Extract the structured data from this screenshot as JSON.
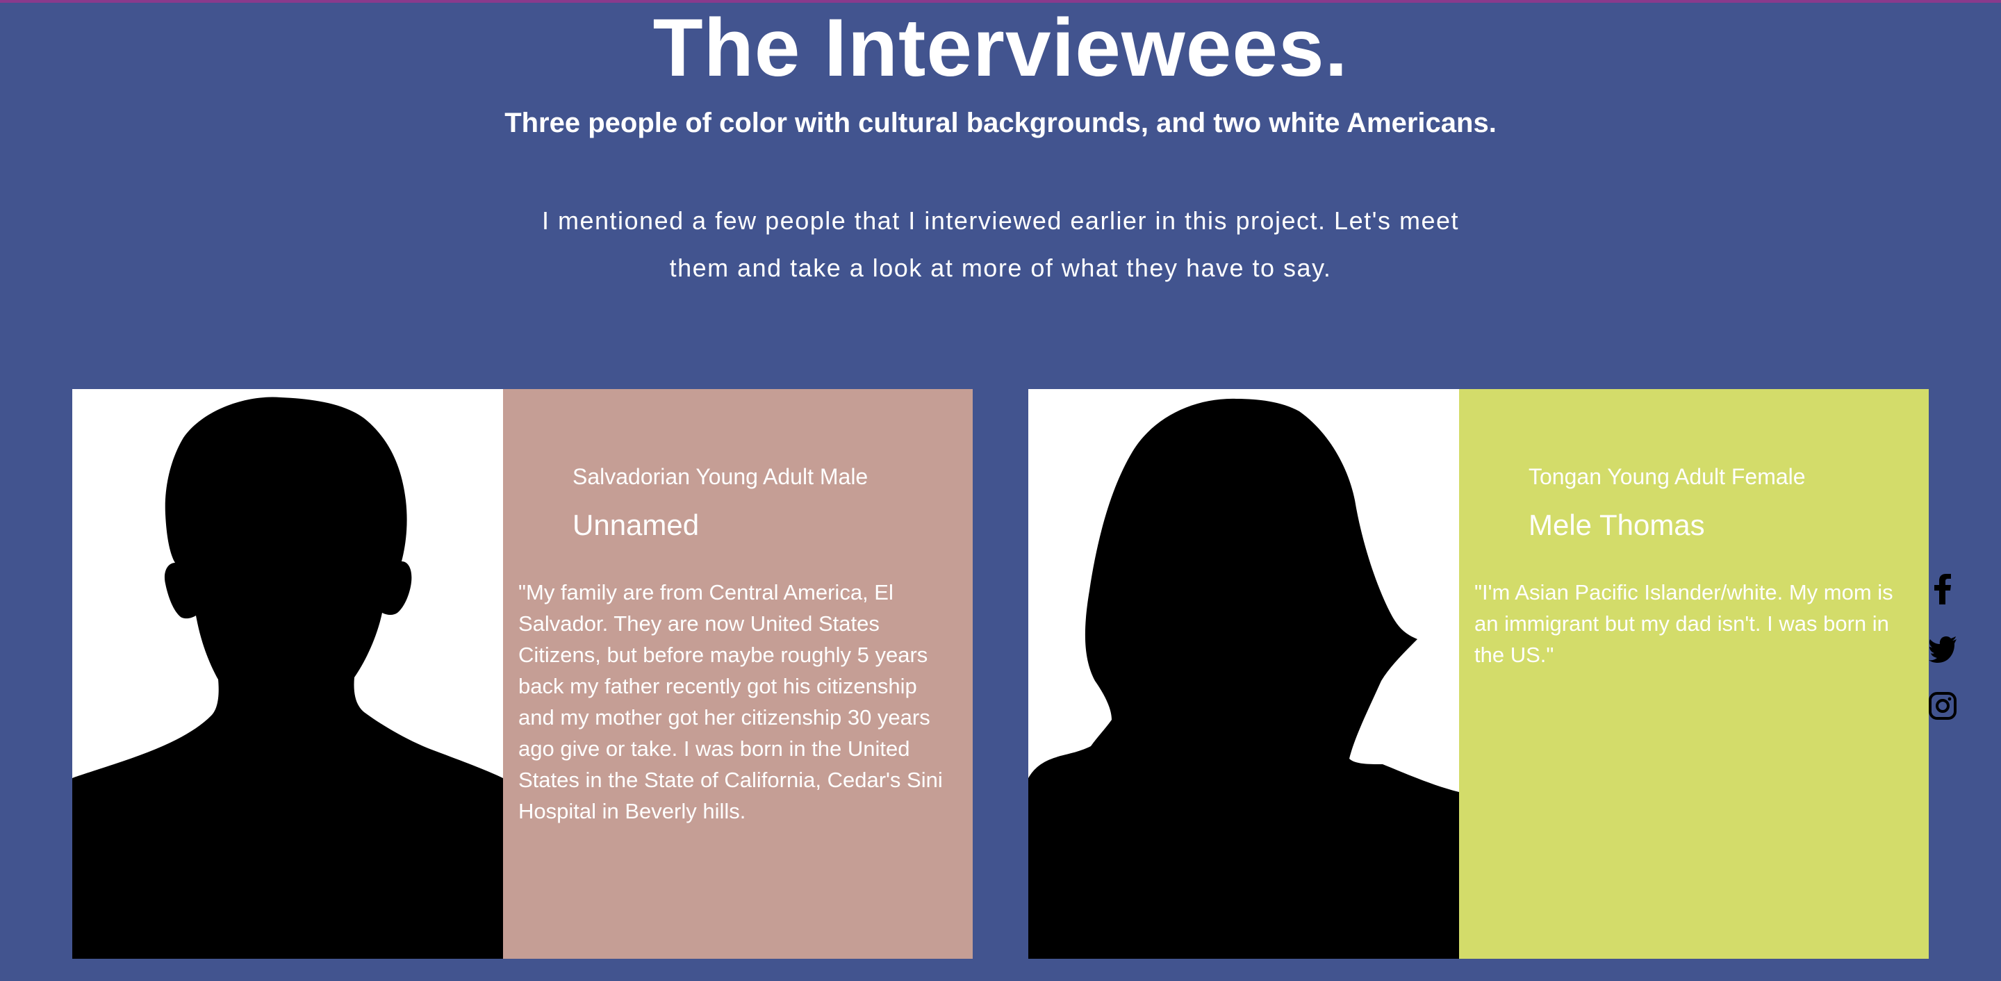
{
  "header": {
    "title": "The Interviewees.",
    "subtitle": "Three people of color with cultural backgrounds, and two white Americans.",
    "intro": "I mentioned a few people that I interviewed earlier in this project. Let's meet them and take a look at more of what they have to say."
  },
  "cards": [
    {
      "eyebrow": "Salvadorian Young Adult Male",
      "name": "Unnamed",
      "quote": "\"My family are from Central America, El Salvador. They are now United States Citizens, but before maybe roughly 5 years back my father recently got his citizenship and my mother got her citizenship 30 years ago give or take. I was born in the United States in the State of California, Cedar's Sini Hospital in Beverly hills.",
      "panel_color": "#c59e95",
      "silhouette": "male-silhouette"
    },
    {
      "eyebrow": "Tongan Young Adult Female",
      "name": "Mele Thomas",
      "quote": "\"I'm Asian Pacific Islander/white. My mom is an immigrant but my dad isn't. I was born in the US.\"",
      "panel_color": "#d3dc6a",
      "silhouette": "female-silhouette"
    }
  ],
  "social": [
    {
      "icon": "facebook-icon"
    },
    {
      "icon": "twitter-icon"
    },
    {
      "icon": "instagram-icon"
    }
  ],
  "colors": {
    "background": "#42548f",
    "top_strip": "#8a3a8c",
    "text": "#ffffff"
  }
}
